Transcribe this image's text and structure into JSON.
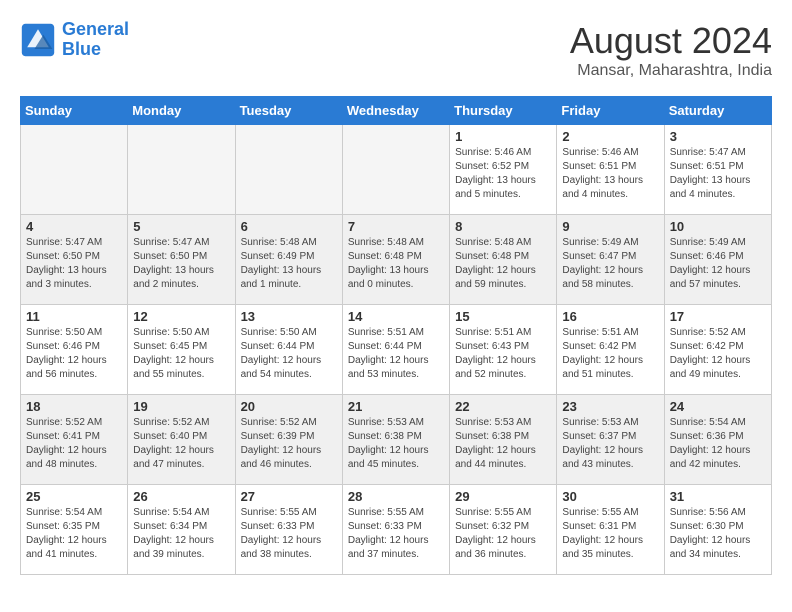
{
  "header": {
    "logo_line1": "General",
    "logo_line2": "Blue",
    "month_year": "August 2024",
    "location": "Mansar, Maharashtra, India"
  },
  "days_of_week": [
    "Sunday",
    "Monday",
    "Tuesday",
    "Wednesday",
    "Thursday",
    "Friday",
    "Saturday"
  ],
  "weeks": [
    [
      {
        "num": "",
        "info": "",
        "empty": true
      },
      {
        "num": "",
        "info": "",
        "empty": true
      },
      {
        "num": "",
        "info": "",
        "empty": true
      },
      {
        "num": "",
        "info": "",
        "empty": true
      },
      {
        "num": "1",
        "info": "Sunrise: 5:46 AM\nSunset: 6:52 PM\nDaylight: 13 hours\nand 5 minutes."
      },
      {
        "num": "2",
        "info": "Sunrise: 5:46 AM\nSunset: 6:51 PM\nDaylight: 13 hours\nand 4 minutes."
      },
      {
        "num": "3",
        "info": "Sunrise: 5:47 AM\nSunset: 6:51 PM\nDaylight: 13 hours\nand 4 minutes."
      }
    ],
    [
      {
        "num": "4",
        "info": "Sunrise: 5:47 AM\nSunset: 6:50 PM\nDaylight: 13 hours\nand 3 minutes."
      },
      {
        "num": "5",
        "info": "Sunrise: 5:47 AM\nSunset: 6:50 PM\nDaylight: 13 hours\nand 2 minutes."
      },
      {
        "num": "6",
        "info": "Sunrise: 5:48 AM\nSunset: 6:49 PM\nDaylight: 13 hours\nand 1 minute."
      },
      {
        "num": "7",
        "info": "Sunrise: 5:48 AM\nSunset: 6:48 PM\nDaylight: 13 hours\nand 0 minutes."
      },
      {
        "num": "8",
        "info": "Sunrise: 5:48 AM\nSunset: 6:48 PM\nDaylight: 12 hours\nand 59 minutes."
      },
      {
        "num": "9",
        "info": "Sunrise: 5:49 AM\nSunset: 6:47 PM\nDaylight: 12 hours\nand 58 minutes."
      },
      {
        "num": "10",
        "info": "Sunrise: 5:49 AM\nSunset: 6:46 PM\nDaylight: 12 hours\nand 57 minutes."
      }
    ],
    [
      {
        "num": "11",
        "info": "Sunrise: 5:50 AM\nSunset: 6:46 PM\nDaylight: 12 hours\nand 56 minutes."
      },
      {
        "num": "12",
        "info": "Sunrise: 5:50 AM\nSunset: 6:45 PM\nDaylight: 12 hours\nand 55 minutes."
      },
      {
        "num": "13",
        "info": "Sunrise: 5:50 AM\nSunset: 6:44 PM\nDaylight: 12 hours\nand 54 minutes."
      },
      {
        "num": "14",
        "info": "Sunrise: 5:51 AM\nSunset: 6:44 PM\nDaylight: 12 hours\nand 53 minutes."
      },
      {
        "num": "15",
        "info": "Sunrise: 5:51 AM\nSunset: 6:43 PM\nDaylight: 12 hours\nand 52 minutes."
      },
      {
        "num": "16",
        "info": "Sunrise: 5:51 AM\nSunset: 6:42 PM\nDaylight: 12 hours\nand 51 minutes."
      },
      {
        "num": "17",
        "info": "Sunrise: 5:52 AM\nSunset: 6:42 PM\nDaylight: 12 hours\nand 49 minutes."
      }
    ],
    [
      {
        "num": "18",
        "info": "Sunrise: 5:52 AM\nSunset: 6:41 PM\nDaylight: 12 hours\nand 48 minutes."
      },
      {
        "num": "19",
        "info": "Sunrise: 5:52 AM\nSunset: 6:40 PM\nDaylight: 12 hours\nand 47 minutes."
      },
      {
        "num": "20",
        "info": "Sunrise: 5:52 AM\nSunset: 6:39 PM\nDaylight: 12 hours\nand 46 minutes."
      },
      {
        "num": "21",
        "info": "Sunrise: 5:53 AM\nSunset: 6:38 PM\nDaylight: 12 hours\nand 45 minutes."
      },
      {
        "num": "22",
        "info": "Sunrise: 5:53 AM\nSunset: 6:38 PM\nDaylight: 12 hours\nand 44 minutes."
      },
      {
        "num": "23",
        "info": "Sunrise: 5:53 AM\nSunset: 6:37 PM\nDaylight: 12 hours\nand 43 minutes."
      },
      {
        "num": "24",
        "info": "Sunrise: 5:54 AM\nSunset: 6:36 PM\nDaylight: 12 hours\nand 42 minutes."
      }
    ],
    [
      {
        "num": "25",
        "info": "Sunrise: 5:54 AM\nSunset: 6:35 PM\nDaylight: 12 hours\nand 41 minutes."
      },
      {
        "num": "26",
        "info": "Sunrise: 5:54 AM\nSunset: 6:34 PM\nDaylight: 12 hours\nand 39 minutes."
      },
      {
        "num": "27",
        "info": "Sunrise: 5:55 AM\nSunset: 6:33 PM\nDaylight: 12 hours\nand 38 minutes."
      },
      {
        "num": "28",
        "info": "Sunrise: 5:55 AM\nSunset: 6:33 PM\nDaylight: 12 hours\nand 37 minutes."
      },
      {
        "num": "29",
        "info": "Sunrise: 5:55 AM\nSunset: 6:32 PM\nDaylight: 12 hours\nand 36 minutes."
      },
      {
        "num": "30",
        "info": "Sunrise: 5:55 AM\nSunset: 6:31 PM\nDaylight: 12 hours\nand 35 minutes."
      },
      {
        "num": "31",
        "info": "Sunrise: 5:56 AM\nSunset: 6:30 PM\nDaylight: 12 hours\nand 34 minutes."
      }
    ]
  ]
}
